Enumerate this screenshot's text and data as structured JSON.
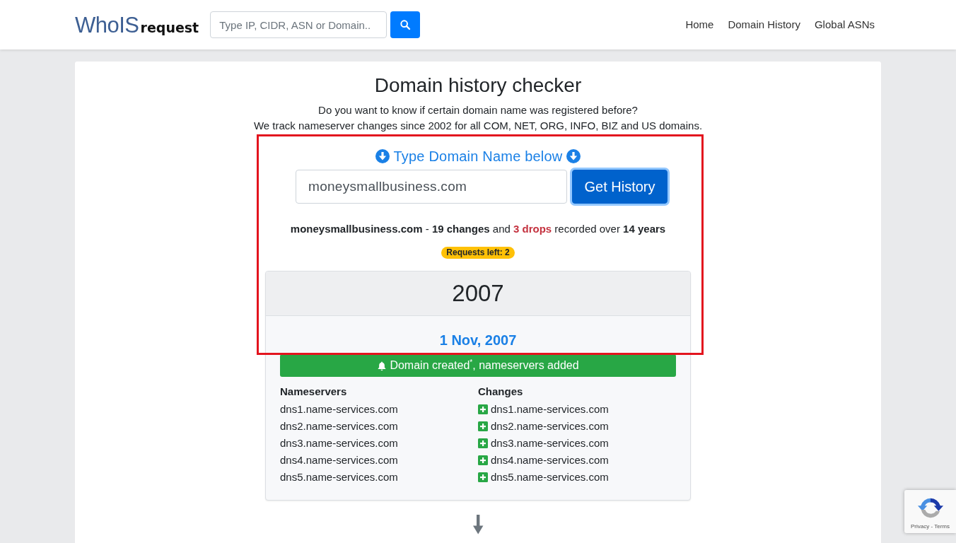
{
  "navbar": {
    "logo": {
      "part_1": "WhoIS",
      "part_2": "request"
    },
    "search": {
      "placeholder": "Type IP, CIDR, ASN or Domain.."
    },
    "links": [
      {
        "label": "Home"
      },
      {
        "label": "Domain History"
      },
      {
        "label": "Global ASNs"
      }
    ]
  },
  "intro": {
    "title": "Domain history checker",
    "subtitle_lines": [
      "Do you want to know if certain domain name was registered before?",
      "We track nameserver changes since 2002 for all COM, NET, ORG, INFO, BIZ and US domains."
    ]
  },
  "lookup": {
    "prompt": "Type Domain Name below",
    "domain_field": {
      "value": "moneysmallbusiness.com"
    },
    "submit_button": {
      "label": "Get History",
      "focused": true
    }
  },
  "summary": [
    {
      "kind": "strong",
      "text": "moneysmallbusiness.com"
    },
    {
      "kind": "plain",
      "text": " - "
    },
    {
      "kind": "strong",
      "text": "19 changes"
    },
    {
      "kind": "plain",
      "text": " and "
    },
    {
      "kind": "alert",
      "text": "3 drops"
    },
    {
      "kind": "plain",
      "text": " recorded over "
    },
    {
      "kind": "strong",
      "text": "14 years"
    }
  ],
  "requests_badge": "Requests left: 2",
  "timeline": [
    {
      "year": "2007",
      "events": [
        {
          "date": "1 Nov, 2007",
          "banner": {
            "kind": "created",
            "text": "Domain created$^{*}$, nameservers added"
          },
          "nameservers": {
            "heading": "Nameservers",
            "items": [
              "dns1.name-services.com",
              "dns2.name-services.com",
              "dns3.name-services.com",
              "dns4.name-services.com",
              "dns5.name-services.com"
            ]
          },
          "changes": {
            "heading": "Changes",
            "items": [
              {
                "kind": "added",
                "text": "dns1.name-services.com"
              },
              {
                "kind": "added",
                "text": "dns2.name-services.com"
              },
              {
                "kind": "added",
                "text": "dns3.name-services.com"
              },
              {
                "kind": "added",
                "text": "dns4.name-services.com"
              },
              {
                "kind": "added",
                "text": "dns5.name-services.com"
              }
            ]
          }
        }
      ]
    }
  ],
  "recaptcha": {
    "links": "Privacy - Terms"
  }
}
